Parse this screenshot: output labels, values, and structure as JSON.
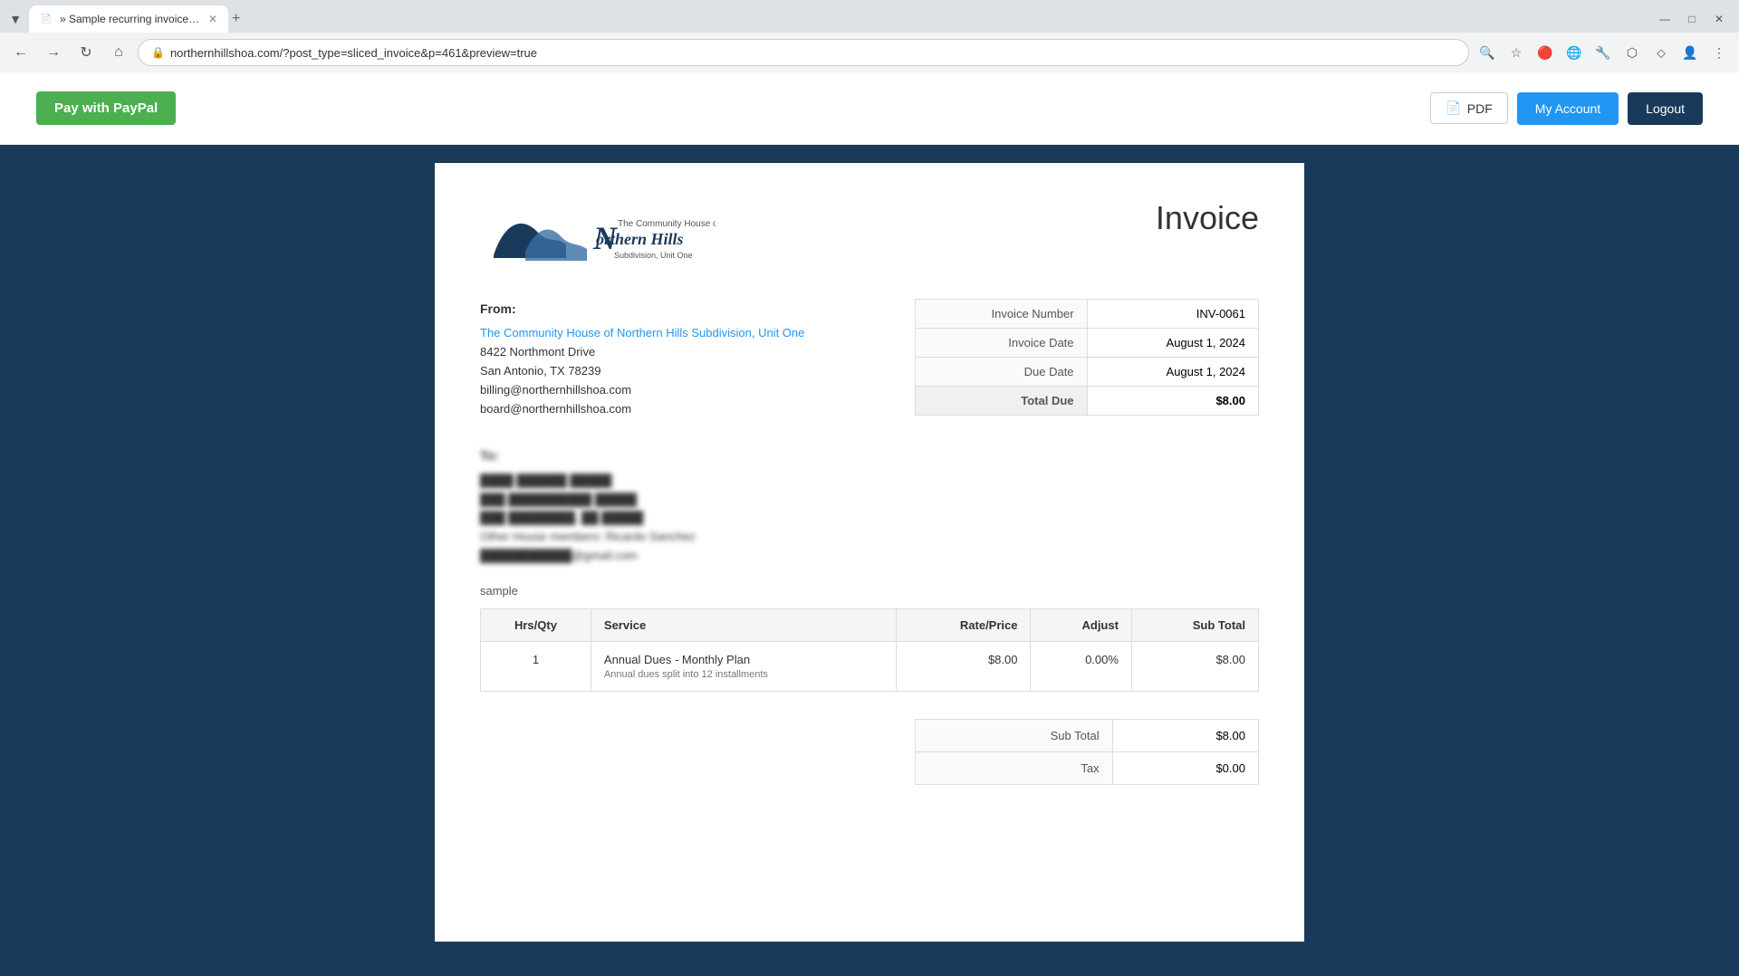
{
  "browser": {
    "tab_title": "» Sample recurring invoiceThe",
    "url": "northernhillshoa.com/?post_type=sliced_invoice&p=461&preview=true",
    "favicon": "📄"
  },
  "header": {
    "paypal_button": "Pay with PayPal",
    "pdf_button": "PDF",
    "my_account_button": "My Account",
    "logout_button": "Logout"
  },
  "invoice": {
    "title": "Invoice",
    "from_label": "From:",
    "company_name": "The Community House of Northern Hills Subdivision, Unit One",
    "address_line1": "8422 Northmont Drive",
    "address_line2": "San Antonio, TX 78239",
    "email1": "billing@northernhillshoa.com",
    "email2": "board@northernhillshoa.com",
    "invoice_number_label": "Invoice Number",
    "invoice_number_value": "INV-0061",
    "invoice_date_label": "Invoice Date",
    "invoice_date_value": "August 1, 2024",
    "due_date_label": "Due Date",
    "due_date_value": "August 1, 2024",
    "total_due_label": "Total Due",
    "total_due_value": "$8.00",
    "to_label": "To:",
    "to_line1": "████ ██████ █████",
    "to_line2": "███ ██████████ █████",
    "to_line3": "███ ████████, ██ █████",
    "to_line4": "Other House members: Ricardo Sanchez",
    "to_line5": "███████████@gmail.com",
    "sample_label": "sample",
    "table_headers": {
      "hrs_qty": "Hrs/Qty",
      "service": "Service",
      "rate_price": "Rate/Price",
      "adjust": "Adjust",
      "sub_total": "Sub Total"
    },
    "line_items": [
      {
        "qty": "1",
        "service": "Annual Dues - Monthly Plan",
        "service_desc": "Annual dues split into 12 installments",
        "rate": "$8.00",
        "adjust": "0.00%",
        "subtotal": "$8.00"
      }
    ],
    "sub_total_label": "Sub Total",
    "sub_total_value": "$8.00",
    "tax_label": "Tax",
    "tax_value": "$0.00"
  }
}
